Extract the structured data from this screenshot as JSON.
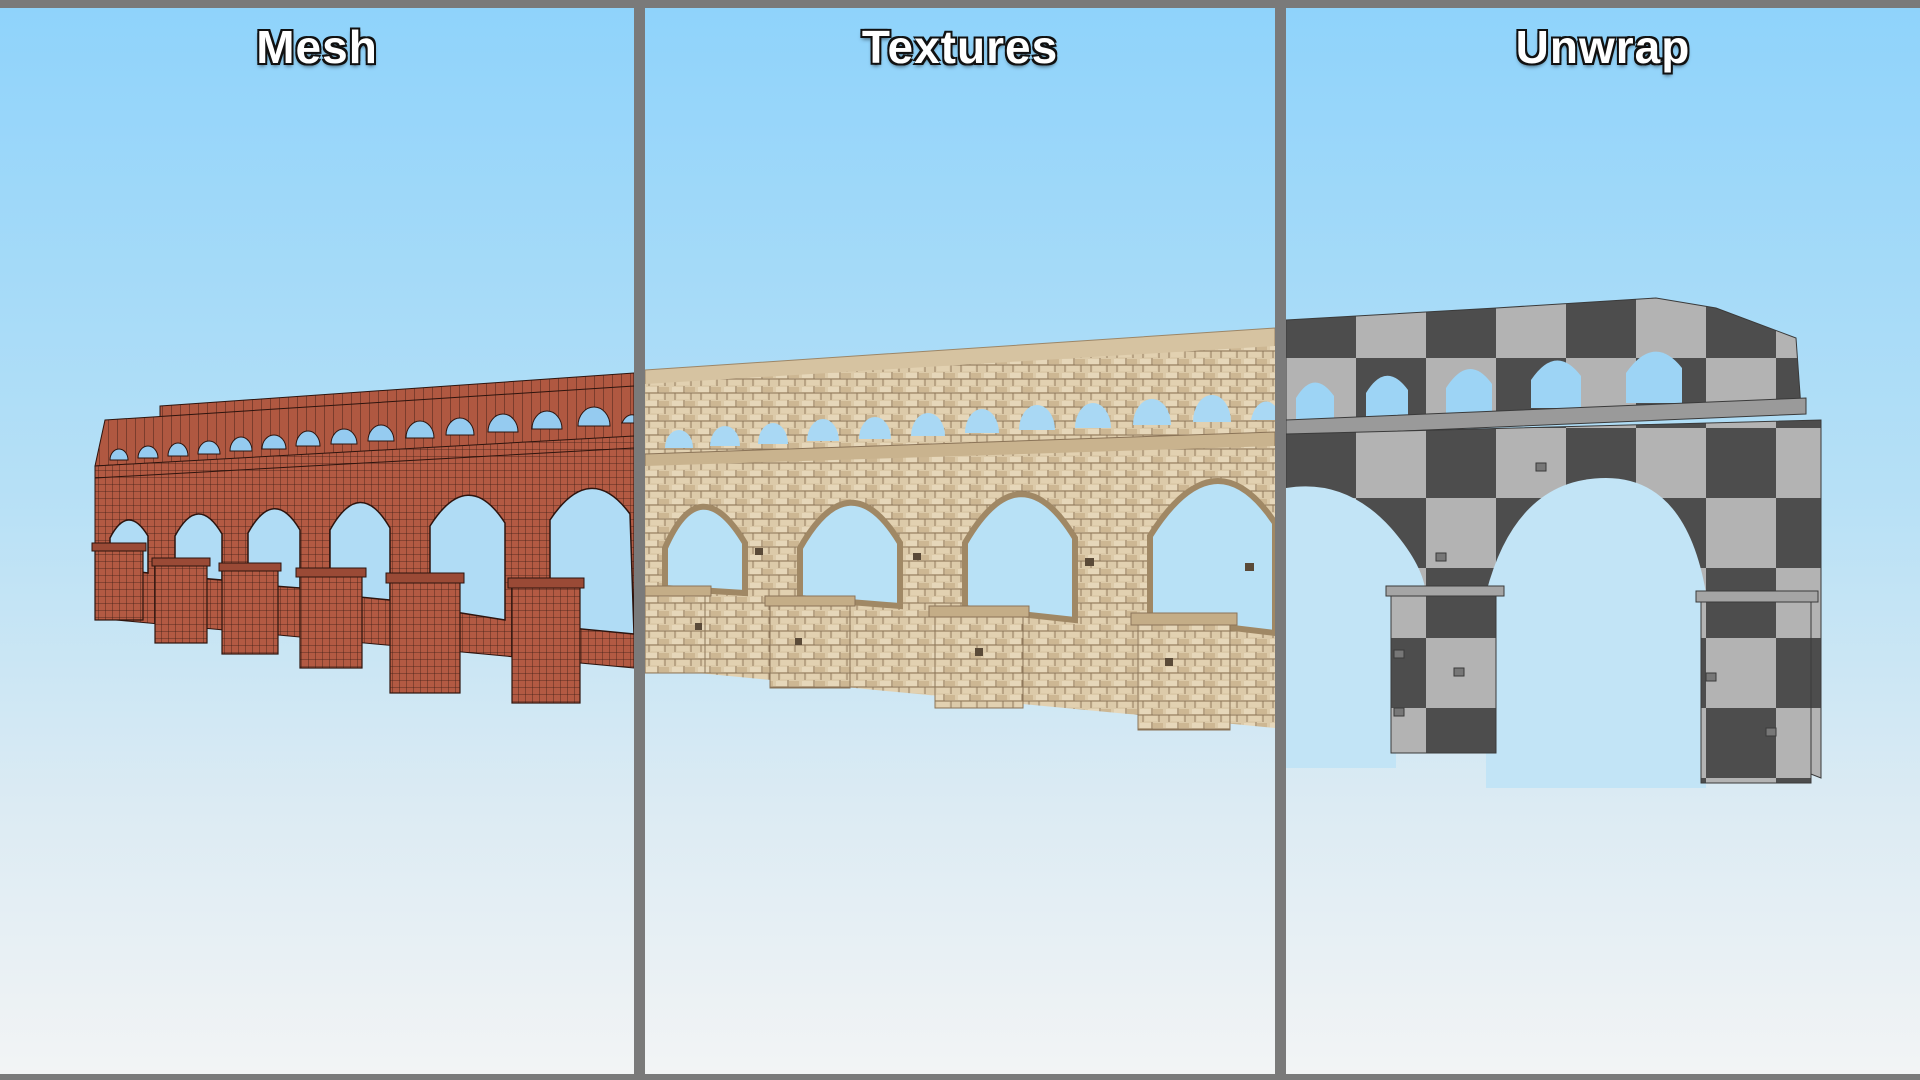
{
  "panels": [
    {
      "title": "Mesh",
      "style": "wireframe",
      "color": "#b35a43"
    },
    {
      "title": "Textures",
      "style": "stone",
      "color": "#d9c6a5"
    },
    {
      "title": "Unwrap",
      "style": "checker",
      "colors": [
        "#b3b3b3",
        "#4d4d4d"
      ]
    }
  ],
  "divider_color": "#7a7a7a"
}
